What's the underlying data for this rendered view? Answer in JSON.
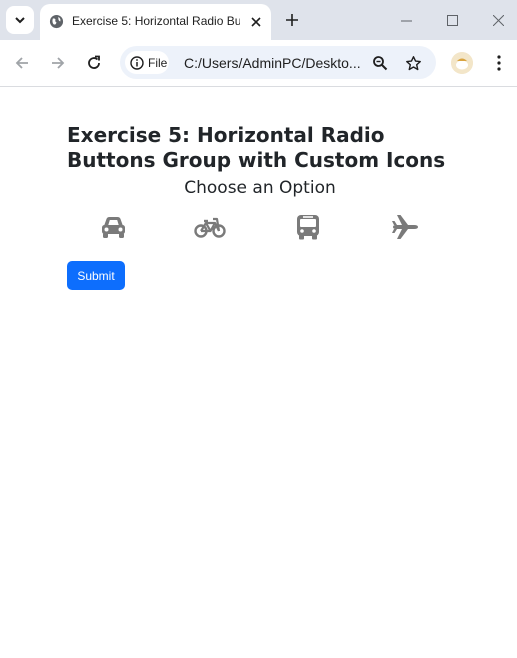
{
  "browser": {
    "tab_title": "Exercise 5: Horizontal Radio Butt",
    "site_chip_label": "File",
    "url": "C:/Users/AdminPC/Deskto...",
    "tab_search_icon": "chevron-down-icon",
    "tab_favicon_icon": "globe-icon"
  },
  "page": {
    "title": "Exercise 5: Horizontal Radio Buttons Group with Custom Icons",
    "subtitle": "Choose an Option",
    "options": [
      {
        "icon": "car-icon"
      },
      {
        "icon": "bicycle-icon"
      },
      {
        "icon": "bus-icon"
      },
      {
        "icon": "plane-icon"
      }
    ],
    "submit_label": "Submit",
    "colors": {
      "icon": "#7a7a7a",
      "button": "#0d6efd",
      "tab_strip": "#dfe3eb",
      "omnibox": "#edf2fa"
    }
  }
}
